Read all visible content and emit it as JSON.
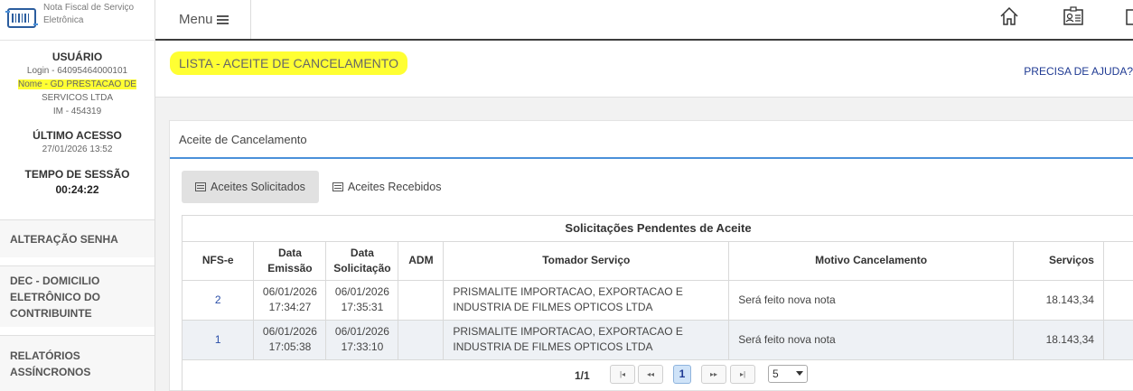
{
  "app": {
    "name_line1": "Nota Fiscal de Serviço",
    "name_line2": "Eletrônica"
  },
  "user": {
    "title": "USUÁRIO",
    "login": "Login - 64095464000101",
    "name_line1": "Nome - GD PRESTACAO DE",
    "name_line2": "SERVICOS LTDA",
    "im": "IM - 454319",
    "last_access_title": "ÚLTIMO ACESSO",
    "last_access": "27/01/2026 13:52",
    "session_title": "TEMPO DE SESSÃO",
    "session_time": "00:24:22"
  },
  "sidebar": {
    "items": [
      {
        "label": "ALTERAÇÃO SENHA"
      },
      {
        "line1": "DEC - DOMICILIO",
        "line2": "ELETRÔNICO DO",
        "line3": "CONTRIBUINTE"
      },
      {
        "line1": "RELATÓRIOS",
        "line2": "ASSÍNCRONOS"
      }
    ]
  },
  "topbar": {
    "menu_label": "Menu",
    "icons": [
      "home-icon",
      "id-card-icon",
      "document-icon"
    ]
  },
  "header": {
    "title": "LISTA - ACEITE DE CANCELAMENTO",
    "help": "PRECISA DE AJUDA?"
  },
  "panel": {
    "title": "Aceite de Cancelamento",
    "tabs": [
      {
        "label": "Aceites Solicitados",
        "active": true
      },
      {
        "label": "Aceites Recebidos",
        "active": false
      }
    ]
  },
  "table": {
    "caption": "Solicitações Pendentes de Aceite",
    "headers": {
      "nfse": "NFS-e",
      "emissao1": "Data",
      "emissao2": "Emissão",
      "solic1": "Data",
      "solic2": "Solicitação",
      "adm": "ADM",
      "tomador": "Tomador Serviço",
      "motivo": "Motivo Cancelamento",
      "servicos": "Serviços"
    },
    "rows": [
      {
        "nfse": "2",
        "emissao_date": "06/01/2026",
        "emissao_time": "17:34:27",
        "solic_date": "06/01/2026",
        "solic_time": "17:35:31",
        "adm": "",
        "tomador1": "PRISMALITE IMPORTACAO, EXPORTACAO E",
        "tomador2": "INDUSTRIA DE FILMES OPTICOS LTDA",
        "motivo": "Será feito nova nota",
        "servicos": "18.143,34"
      },
      {
        "nfse": "1",
        "emissao_date": "06/01/2026",
        "emissao_time": "17:05:38",
        "solic_date": "06/01/2026",
        "solic_time": "17:33:10",
        "adm": "",
        "tomador1": "PRISMALITE IMPORTACAO, EXPORTACAO E",
        "tomador2": "INDUSTRIA DE FILMES OPTICOS LTDA",
        "motivo": "Será feito nova nota",
        "servicos": "18.143,34"
      }
    ]
  },
  "pager": {
    "info": "1/1",
    "first": "|◂",
    "prev": "◂◂",
    "current": "1",
    "next": "▸▸",
    "last": "▸|",
    "page_size": "5"
  },
  "colors": {
    "highlight": "#ffff33",
    "accent_blue": "#4a90d9",
    "link_blue": "#1f3a93"
  }
}
